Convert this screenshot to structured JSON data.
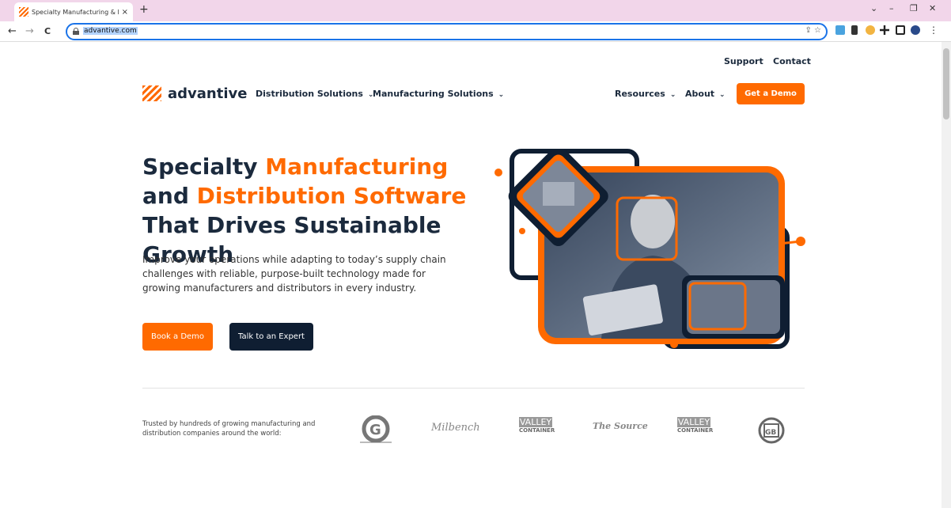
{
  "browser": {
    "tab_title": "Specialty Manufacturing & Distr",
    "tab_close": "×",
    "new_tab": "+",
    "url": "advantive.com",
    "back": "←",
    "forward": "→",
    "reload": "C",
    "omni_icons": "⇪ ☆",
    "win_min": "–",
    "win_restore": "❐",
    "win_close": "✕",
    "tab_menu": "⌄",
    "menu_dots": "⋮"
  },
  "header": {
    "support": "Support",
    "contact": "Contact",
    "logo_text": "advantive",
    "nav": [
      "Distribution Solutions",
      "Manufacturing Solutions",
      "Resources",
      "About"
    ],
    "chevron": "⌄",
    "cta": "Get a Demo"
  },
  "hero": {
    "h1_part1": "Specialty ",
    "h1_hl1": "Manufacturing",
    "h1_part2": " and ",
    "h1_hl2": "Distribution Software",
    "h1_part3": " That Drives Sustainable Growth",
    "lead": "Improve your operations while adapting to today’s supply chain challenges with reliable, purpose-built technology made for growing manufacturers and distributors in every industry.",
    "btn_demo": "Book a Demo",
    "btn_expert": "Talk to an Expert"
  },
  "trusted": {
    "text": "Trusted by hundreds of growing manufacturing and distribution companies around the world:",
    "logos": [
      "G",
      "Milbench",
      "VALLEY",
      "CONTAINER",
      "The Source",
      "VALLEY",
      "CONTAINER",
      "GB"
    ]
  },
  "colors": {
    "accent": "#ff6a00",
    "navy": "#1b2a3d",
    "dark": "#0f1e32"
  }
}
